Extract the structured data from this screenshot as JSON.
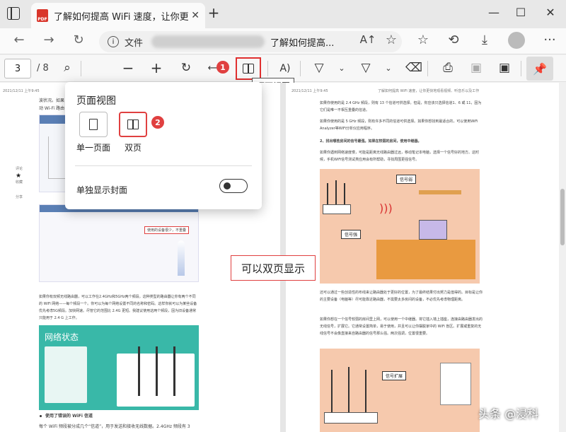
{
  "tab": {
    "pdf_badge": "PDF",
    "title": "了解如何提高 WiFi 速度，让你更快",
    "close": "✕"
  },
  "window": {
    "new_tab": "+",
    "minimize": "—",
    "maximize": "☐",
    "close": "✕"
  },
  "address": {
    "file_label": "文件",
    "url_text": "了解如何提高..."
  },
  "pdf_toolbar": {
    "page_number": "3",
    "page_total": "/ 8"
  },
  "tooltip": {
    "page_view": "页面视图"
  },
  "popup": {
    "title": "页面视图",
    "option_single": "单一页面",
    "option_double": "双页",
    "badge1": "1",
    "badge2": "2",
    "cover_label": "单独显示封面"
  },
  "callout": "可以双页显示",
  "left_page": {
    "header_date": "2021/12/11 上午9:45",
    "line1": "波状况。如果",
    "line2": "动 Wi-Fi 路由",
    "sidebar1": "评论",
    "sidebar2": "收藏",
    "sidebar3": "分享",
    "para1": "如果你有双频无线路由器，可以工作在2.4GHz和5GHz两个频段。这种类型的路由器让你有两个不同的 WiFi 网络——每个频段一个。你可以为每个网络设置不同的名称和密码。这样你就可以为某些设备优先考虑5G频段。加快网速。尽管它的范围比 2.4G 更短。我建议使用这两个频段，因为旧设备通常只能用于 2.4 G 上工作。",
    "chart_label": "使用的设备很少，不重叠",
    "network_status": "网络状态",
    "bullet_heading": "使用了错误的 WiFi 信道",
    "bottom_line": "每个 WiFi 频段被分成几个“信道”，用于发送和接收无线数据。2.4GHz 频段有 3"
  },
  "right_page": {
    "header_title": "了解如何提高 WiFi 速度，让你更快地观看视频、听音乐以及工作",
    "p1": "如果你使用的是 2.4 GHz 频段，则有 13 个信道可供选择。但是，你应该只选择信道1、6 或 11，因为它们是唯一不相互重叠的信道。",
    "p2": "如果你使用的是 5 GHz 频段，则有许多不同的信道可供选择。如果你想找到最适合的，可以使用WiFi Analyzer等WiFi分析仪应用程序。",
    "heading2": "2、找出哪些房间的信号最强。如果在较弱的房间，使用中继器。",
    "p3": "如果你遇到网络速度慢，可能是距离无线路由器过远，移动笔记本电脑，选择一个信号好的地方。这时候，手机WiFi信号测试类应用会有所帮助，寻找周围更强信号。",
    "label_weak": "信号弱",
    "label_strong": "信号强",
    "p4": "还可以通过一些创造性的布线来让路由器处于更好的位置，为了最终结果付出努力是值得的。目标是让你的主要设备（电脑等）尽可能靠近路由器，不需要太多房间的设备，不必优先考虑物理距离。",
    "p5": "如果你想在一个信号较弱的房间里上网，可以使用一个中继器。将它插入墙上插座，连接由路由器发出的无线信号，扩展它。它通常设置简单，易于使用，并且可以让你摆脱家中的 WiFi 盲区。扩展或重复的无线信号不会像直接来自路由器的信号那么强。两次强调，位置很重要。",
    "label_ext": "信号扩展"
  },
  "watermark": "头条 @浸科"
}
